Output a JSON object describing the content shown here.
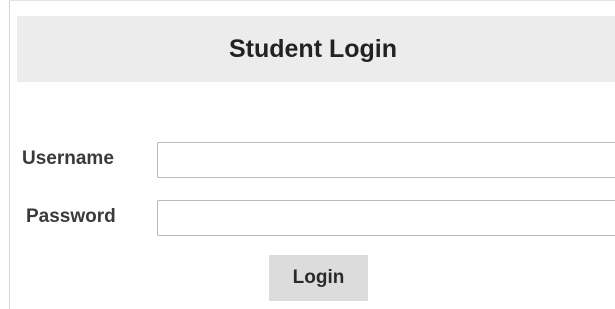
{
  "login_panel": {
    "title": "Student Login",
    "username": {
      "label": "Username",
      "value": "",
      "placeholder": ""
    },
    "password": {
      "label": "Password",
      "value": "",
      "placeholder": ""
    },
    "submit_label": "Login"
  },
  "colors": {
    "header_background": "#ececec",
    "button_background": "#dcdcdc",
    "input_border": "#b9b9b9",
    "label_text": "#3a3a3a"
  }
}
